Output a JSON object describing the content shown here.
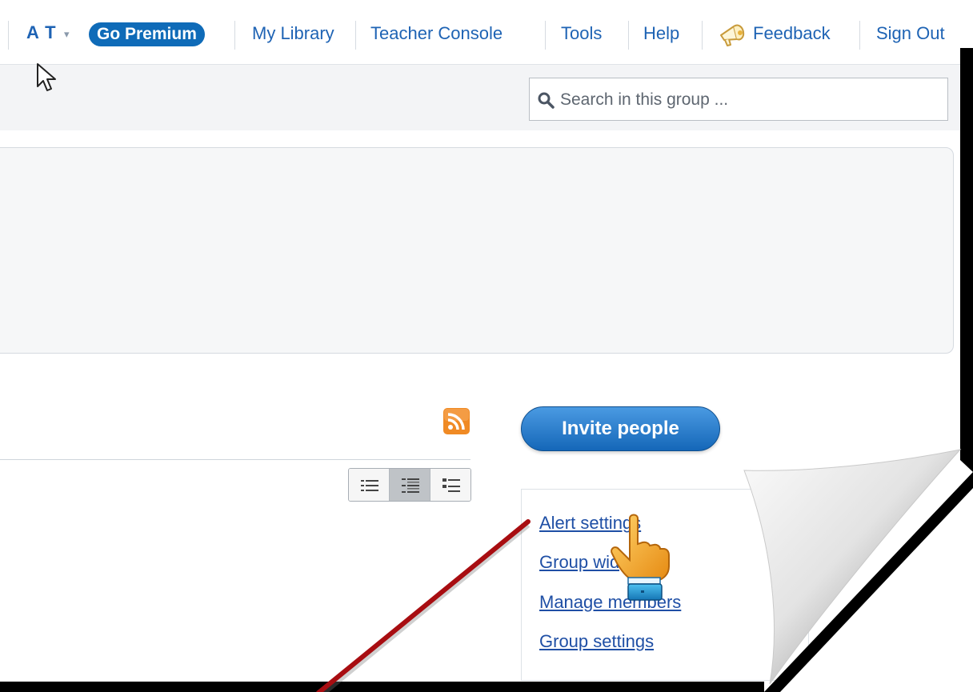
{
  "nav": {
    "user": "A T",
    "caret": "▾",
    "premium": "Go Premium",
    "my_library": "My Library",
    "teacher_console": "Teacher Console",
    "tools": "Tools",
    "help": "Help",
    "feedback": "Feedback",
    "sign_out": "Sign Out"
  },
  "search": {
    "placeholder": "Search in this group ..."
  },
  "actions": {
    "invite": "Invite people"
  },
  "admin_links": [
    {
      "label": "Alert settings"
    },
    {
      "label": "Group widgets"
    },
    {
      "label": "Manage members"
    },
    {
      "label": "Group settings"
    }
  ],
  "colors": {
    "link_blue": "#1e63b4",
    "premium_bg": "#0f6bb8",
    "invite_bg": "#1567b8",
    "annotation_red": "#a80d11",
    "rss_orange": "#f08a24"
  },
  "icons": {
    "search": "magnifier-icon",
    "feedback": "megaphone-icon",
    "rss": "rss-icon",
    "cursor": "arrow-cursor-icon",
    "hand": "hand-pointer-icon"
  }
}
